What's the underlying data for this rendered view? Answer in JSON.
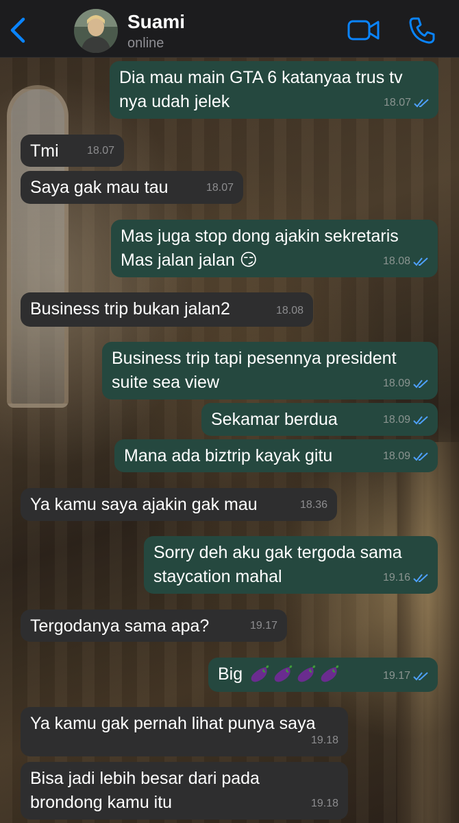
{
  "header": {
    "contact_name": "Suami",
    "status": "online",
    "icons": {
      "back": "chevron-left-icon",
      "video": "video-camera-icon",
      "call": "phone-icon"
    },
    "accent_color": "#0a84ff"
  },
  "theme": {
    "outgoing_bubble": "#25483f",
    "incoming_bubble": "#2e2e2f",
    "read_ticks": "#4ea1ff"
  },
  "messages": [
    {
      "dir": "out",
      "lines": [
        "Dia mau main GTA 6 katanyaa trus tv",
        "nya udah jelek"
      ],
      "time": "18.07",
      "read": true
    },
    {
      "dir": "in",
      "lines": [
        "Tmi"
      ],
      "time": "18.07"
    },
    {
      "dir": "in",
      "lines": [
        "Saya gak mau tau"
      ],
      "time": "18.07"
    },
    {
      "dir": "out",
      "lines": [
        "Mas juga stop dong ajakin sekretaris",
        "Mas jalan jalan 😏"
      ],
      "time": "18.08",
      "read": true
    },
    {
      "dir": "in",
      "lines": [
        "Business trip bukan jalan2"
      ],
      "time": "18.08"
    },
    {
      "dir": "out",
      "lines": [
        "Business trip tapi pesennya president",
        "suite sea view"
      ],
      "time": "18.09",
      "read": true
    },
    {
      "dir": "out",
      "lines": [
        "Sekamar berdua"
      ],
      "time": "18.09",
      "read": true
    },
    {
      "dir": "out",
      "lines": [
        "Mana ada biztrip kayak gitu"
      ],
      "time": "18.09",
      "read": true
    },
    {
      "dir": "in",
      "lines": [
        "Ya kamu saya ajakin gak mau"
      ],
      "time": "18.36"
    },
    {
      "dir": "out",
      "lines": [
        "Sorry deh aku gak tergoda sama",
        "staycation mahal"
      ],
      "time": "19.16",
      "read": true
    },
    {
      "dir": "in",
      "lines": [
        "Tergodanya sama apa?"
      ],
      "time": "19.17"
    },
    {
      "dir": "out",
      "lines": [
        "Big"
      ],
      "emoji": "eggplant-icon",
      "emoji_count": 4,
      "time": "19.17",
      "read": true
    },
    {
      "dir": "in",
      "lines": [
        "Ya kamu gak pernah lihat punya saya"
      ],
      "time": "19.18"
    },
    {
      "dir": "in",
      "lines": [
        "Bisa jadi lebih besar dari pada",
        "brondong kamu itu"
      ],
      "time": "19.18"
    }
  ]
}
